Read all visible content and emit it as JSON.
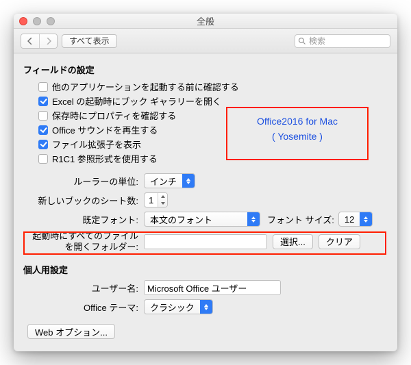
{
  "titlebar": {
    "title": "全般"
  },
  "toolbar": {
    "show_all": "すべて表示",
    "search_placeholder": "検索"
  },
  "field_settings": {
    "heading": "フィールドの設定",
    "options": [
      {
        "label": "他のアプリケーションを起動する前に確認する",
        "checked": false
      },
      {
        "label": "Excel の起動時にブック ギャラリーを開く",
        "checked": true
      },
      {
        "label": "保存時にプロパティを確認する",
        "checked": false
      },
      {
        "label": "Office サウンドを再生する",
        "checked": true
      },
      {
        "label": "ファイル拡張子を表示",
        "checked": true
      },
      {
        "label": "R1C1 参照形式を使用する",
        "checked": false
      }
    ],
    "ruler_units": {
      "label": "ルーラーの単位:",
      "value": "インチ"
    },
    "sheets_in_new": {
      "label": "新しいブックのシート数:",
      "value": "1"
    },
    "default_font": {
      "label": "既定フォント:",
      "value": "本文のフォント",
      "size_label": "フォント サイズ:",
      "size_value": "12"
    },
    "startup_folder": {
      "label_line1": "起動時にすべてのファイル",
      "label_line2": "を開くフォルダー:",
      "value": "",
      "choose": "選択...",
      "clear": "クリア"
    }
  },
  "personal": {
    "heading": "個人用設定",
    "username": {
      "label": "ユーザー名:",
      "value": "Microsoft Office ユーザー"
    },
    "theme": {
      "label": "Office テーマ:",
      "value": "クラシック"
    }
  },
  "web_options": "Web オプション...",
  "callout": {
    "line1": "Office2016 for Mac",
    "line2": "( Yosemite )"
  }
}
